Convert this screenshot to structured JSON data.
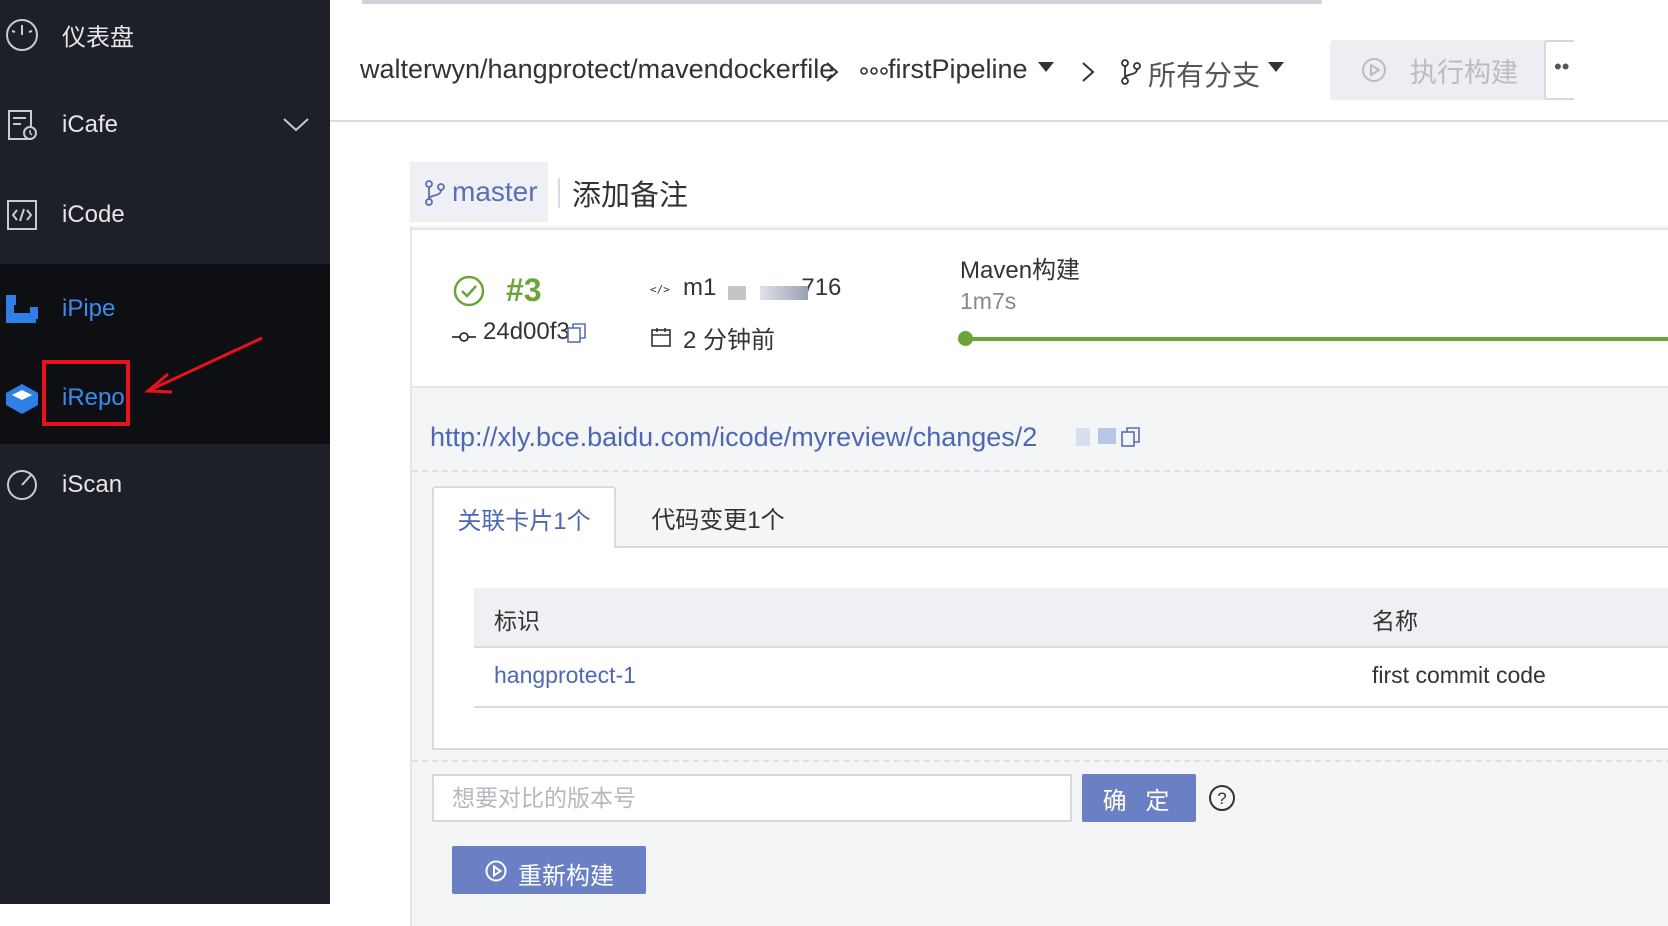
{
  "sidebar": {
    "items": [
      {
        "label": "仪表盘",
        "icon": "dashboard-icon"
      },
      {
        "label": "iCafe",
        "icon": "icafe-icon",
        "expandable": true
      },
      {
        "label": "iCode",
        "icon": "code-icon"
      },
      {
        "label": "iPipe",
        "icon": "ipipe-icon",
        "active": true
      },
      {
        "label": "iRepo",
        "icon": "irepo-icon",
        "highlighted": true
      },
      {
        "label": "iScan",
        "icon": "iscan-icon"
      }
    ]
  },
  "header": {
    "repo_path": "walterwyn/hangprotect/mavendockerfile",
    "pipeline": "firstPipeline",
    "branch": "所有分支",
    "run_button": "执行构建"
  },
  "build": {
    "branch_tag": "master",
    "add_note": "添加备注",
    "number": "#3",
    "commit_hash": "24d00f3",
    "committer_prefix": "m1",
    "committer_suffix": "716",
    "time_ago": "2 分钟前",
    "stage_name": "Maven构建",
    "stage_duration": "1m7s",
    "review_url": "http://xly.bce.baidu.com/icode/myreview/changes/2"
  },
  "tabs": {
    "cards": "关联卡片1个",
    "changes": "代码变更1个"
  },
  "table": {
    "headers": {
      "id": "标识",
      "name": "名称"
    },
    "rows": [
      {
        "id": "hangprotect-1",
        "name": "first commit code"
      }
    ]
  },
  "compare": {
    "placeholder": "想要对比的版本号",
    "confirm": "确 定"
  },
  "rebuild_label": "重新构建",
  "colors": {
    "sidebar_bg": "#1e2029",
    "accent_blue": "#3a8bf0",
    "button_blue": "#6b7fc4",
    "success_green": "#6ba53a",
    "highlight_red": "#e8121d"
  }
}
